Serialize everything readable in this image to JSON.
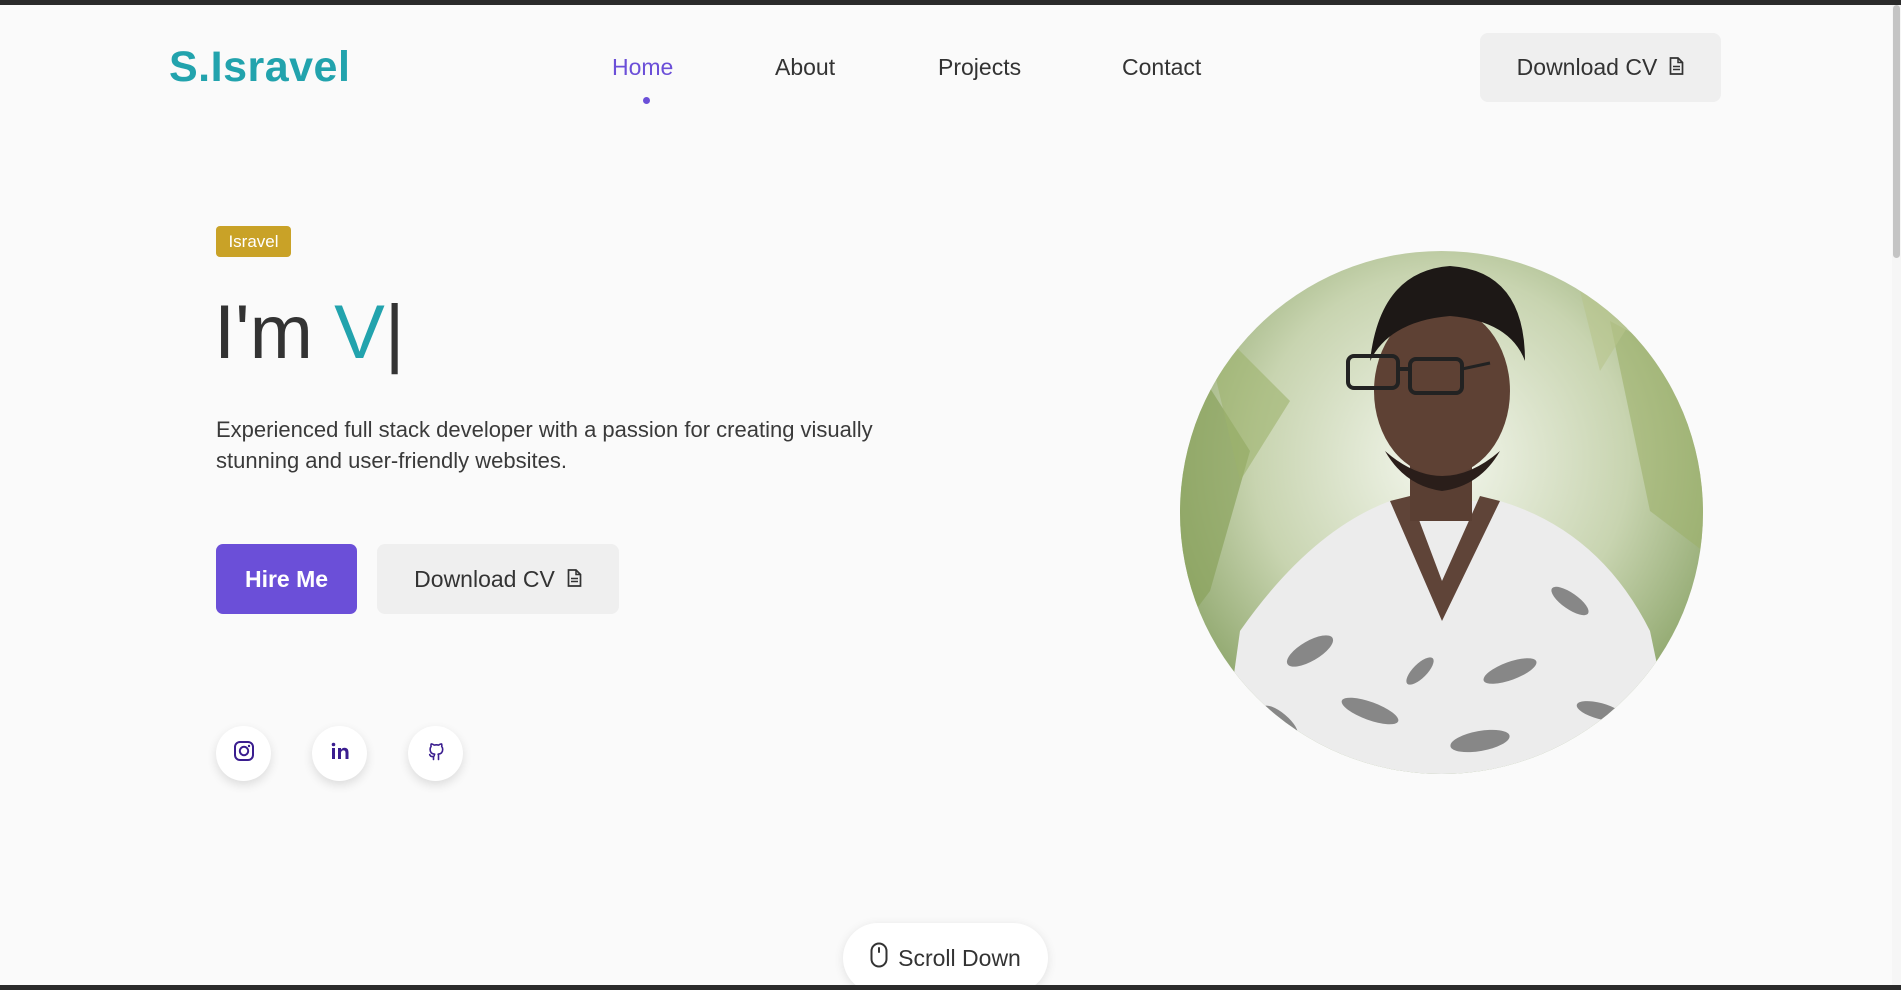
{
  "header": {
    "logo": "S.Isravel",
    "nav": [
      "Home",
      "About",
      "Projects",
      "Contact"
    ],
    "active_nav": "Home",
    "download_cv_label": "Download CV"
  },
  "hero": {
    "badge": "Isravel",
    "greeting": "I'm",
    "typed_text": "V",
    "cursor": "|",
    "description": "Experienced full stack developer with a passion for creating visually stunning and user-friendly websites.",
    "hire_label": "Hire Me",
    "download_cv_label": "Download CV"
  },
  "social": [
    "instagram-icon",
    "linkedin-icon",
    "github-icon"
  ],
  "scroll_down_label": "Scroll Down",
  "colors": {
    "accent_teal": "#22a3ad",
    "accent_purple": "#6b4fd8",
    "badge_gold": "#c9a227",
    "background": "#fafafa"
  }
}
